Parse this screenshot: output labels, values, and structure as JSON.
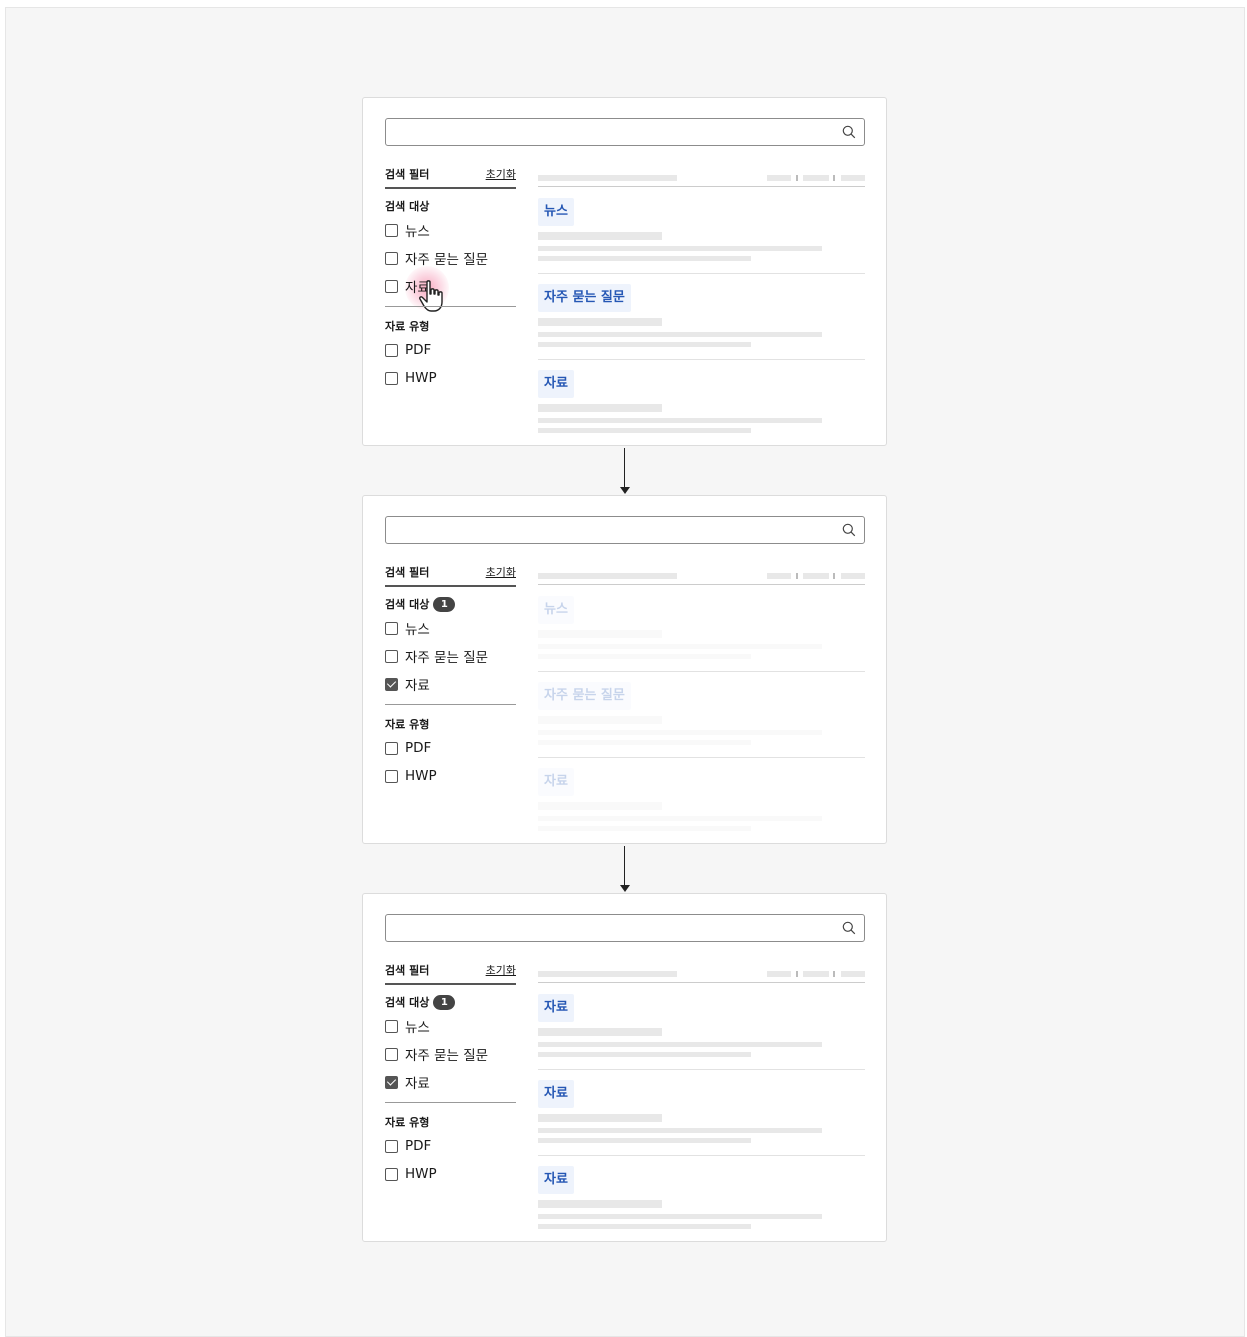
{
  "filters": {
    "title": "검색 필터",
    "reset_label": "초기화",
    "target_section": "검색 대상",
    "type_section": "자료 유형",
    "badge_count": "1",
    "options_target": [
      "뉴스",
      "자주 묻는 질문",
      "자료"
    ],
    "options_type": [
      "PDF",
      "HWP"
    ]
  },
  "panel1": {
    "checked": {
      "자료": false
    },
    "results": [
      "뉴스",
      "자주 묻는 질문",
      "자료"
    ]
  },
  "panel2": {
    "checked": {
      "자료": true
    },
    "results": [
      "뉴스",
      "자주 묻는 질문",
      "자료"
    ],
    "results_state": "loading"
  },
  "panel3": {
    "checked": {
      "자료": true
    },
    "results": [
      "자료",
      "자료",
      "자료"
    ]
  },
  "colors": {
    "tag_bg": "#eef3fc",
    "tag_text": "#2557b4",
    "badge_bg": "#444444",
    "cursor_highlight": "#f06490"
  },
  "icons": [
    "search-icon",
    "hand-pointer-icon",
    "arrow-down-icon",
    "checkbox-checked-icon"
  ]
}
